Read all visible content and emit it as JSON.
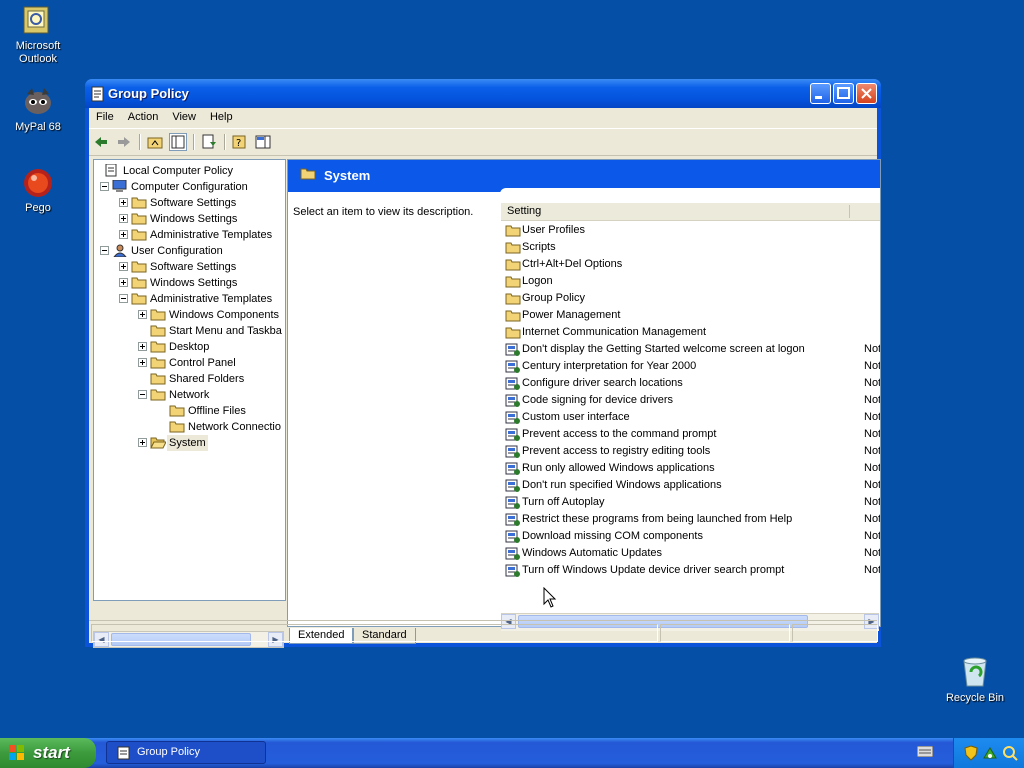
{
  "desktop": {
    "icons": [
      {
        "label": "Microsoft Outlook",
        "icon": "outlook-icon"
      },
      {
        "label": "MyPal 68",
        "icon": "mypal-icon"
      },
      {
        "label": "Pego",
        "icon": "pego-icon"
      }
    ],
    "recycle_bin": {
      "label": "Recycle Bin",
      "icon": "recycle-bin-icon"
    }
  },
  "window": {
    "title": "Group Policy",
    "menu": [
      "File",
      "Action",
      "View",
      "Help"
    ]
  },
  "tree": {
    "items": [
      {
        "label": "Local Computer Policy",
        "level": 0,
        "expander": "none",
        "icon": "policy-icon"
      },
      {
        "label": "Computer Configuration",
        "level": 1,
        "expander": "minus",
        "icon": "computer-icon"
      },
      {
        "label": "Software Settings",
        "level": 2,
        "expander": "plus",
        "icon": "folder-icon"
      },
      {
        "label": "Windows Settings",
        "level": 2,
        "expander": "plus",
        "icon": "folder-icon"
      },
      {
        "label": "Administrative Templates",
        "level": 2,
        "expander": "plus",
        "icon": "folder-icon"
      },
      {
        "label": "User Configuration",
        "level": 1,
        "expander": "minus",
        "icon": "user-icon"
      },
      {
        "label": "Software Settings",
        "level": 2,
        "expander": "plus",
        "icon": "folder-icon"
      },
      {
        "label": "Windows Settings",
        "level": 2,
        "expander": "plus",
        "icon": "folder-icon"
      },
      {
        "label": "Administrative Templates",
        "level": 2,
        "expander": "minus",
        "icon": "folder-icon"
      },
      {
        "label": "Windows Components",
        "level": 3,
        "expander": "plus",
        "icon": "folder-icon"
      },
      {
        "label": "Start Menu and Taskba",
        "level": 3,
        "expander": "none",
        "icon": "folder-icon"
      },
      {
        "label": "Desktop",
        "level": 3,
        "expander": "plus",
        "icon": "folder-icon"
      },
      {
        "label": "Control Panel",
        "level": 3,
        "expander": "plus",
        "icon": "folder-icon"
      },
      {
        "label": "Shared Folders",
        "level": 3,
        "expander": "none",
        "icon": "folder-icon"
      },
      {
        "label": "Network",
        "level": 3,
        "expander": "minus",
        "icon": "folder-icon"
      },
      {
        "label": "Offline Files",
        "level": 4,
        "expander": "none",
        "icon": "folder-icon"
      },
      {
        "label": "Network Connectio",
        "level": 4,
        "expander": "none",
        "icon": "folder-icon"
      },
      {
        "label": "System",
        "level": 3,
        "expander": "plus",
        "icon": "folder-open-icon",
        "selected": true
      }
    ]
  },
  "right": {
    "header": "System",
    "description": "Select an item to view its description.",
    "column_setting": "Setting",
    "rows": [
      {
        "label": "User Profiles",
        "type": "folder",
        "state": ""
      },
      {
        "label": "Scripts",
        "type": "folder",
        "state": ""
      },
      {
        "label": "Ctrl+Alt+Del Options",
        "type": "folder",
        "state": ""
      },
      {
        "label": "Logon",
        "type": "folder",
        "state": ""
      },
      {
        "label": "Group Policy",
        "type": "folder",
        "state": ""
      },
      {
        "label": "Power Management",
        "type": "folder",
        "state": ""
      },
      {
        "label": "Internet Communication Management",
        "type": "folder",
        "state": ""
      },
      {
        "label": "Don't display the Getting Started welcome screen at logon",
        "type": "setting",
        "state": "Not"
      },
      {
        "label": "Century interpretation for Year 2000",
        "type": "setting",
        "state": "Not"
      },
      {
        "label": "Configure driver search locations",
        "type": "setting",
        "state": "Not"
      },
      {
        "label": "Code signing for device drivers",
        "type": "setting",
        "state": "Not"
      },
      {
        "label": "Custom user interface",
        "type": "setting",
        "state": "Not"
      },
      {
        "label": "Prevent access to the command prompt",
        "type": "setting",
        "state": "Not"
      },
      {
        "label": "Prevent access to registry editing tools",
        "type": "setting",
        "state": "Not"
      },
      {
        "label": "Run only allowed Windows applications",
        "type": "setting",
        "state": "Not"
      },
      {
        "label": "Don't run specified Windows applications",
        "type": "setting",
        "state": "Not"
      },
      {
        "label": "Turn off Autoplay",
        "type": "setting",
        "state": "Not"
      },
      {
        "label": "Restrict these programs from being launched from Help",
        "type": "setting",
        "state": "Not"
      },
      {
        "label": "Download missing COM components",
        "type": "setting",
        "state": "Not"
      },
      {
        "label": "Windows Automatic Updates",
        "type": "setting",
        "state": "Not"
      },
      {
        "label": "Turn off Windows Update device driver search prompt",
        "type": "setting",
        "state": "Not"
      }
    ],
    "tabs": [
      "Extended",
      "Standard"
    ]
  },
  "taskbar": {
    "start_label": "start",
    "task_label": "Group Policy"
  },
  "colors": {
    "desktop": "#054fa6",
    "title_blue": "#0553dd",
    "start_green": "#3c9a3c",
    "folder_yellow": "#f2d477"
  }
}
